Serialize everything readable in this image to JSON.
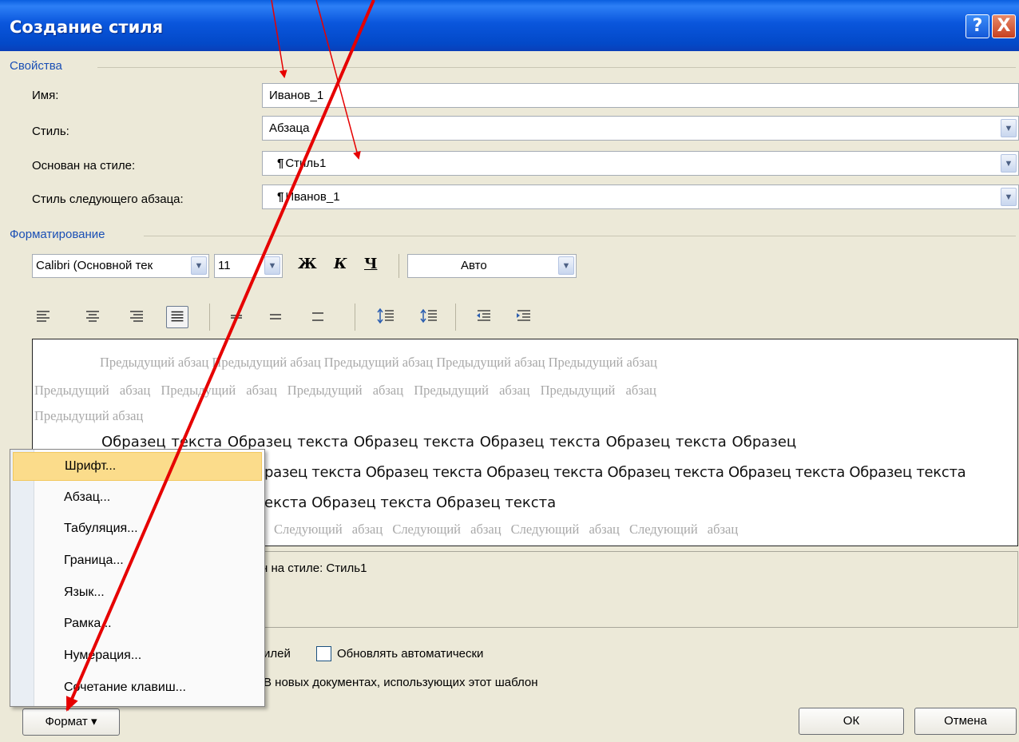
{
  "window": {
    "title": "Создание стиля",
    "help": "?",
    "close": "X"
  },
  "properties": {
    "section": "Свойства",
    "name_label": "Имя:",
    "name_value": "Иванов_1",
    "style_label": "Стиль:",
    "style_value": "Абзаца",
    "based_label": "Основан на стиле:",
    "based_value": "Стиль1",
    "next_label": "Стиль следующего абзаца:",
    "next_value": "Иванов_1"
  },
  "formatting": {
    "section": "Форматирование",
    "font": "Calibri (Основной тек",
    "size": "11",
    "bold": "Ж",
    "italic": "К",
    "underline": "Ч",
    "color": "Авто"
  },
  "preview": {
    "prev_lines": [
      "Предыдущий абзац Предыдущий абзац Предыдущий абзац Предыдущий абзац Предыдущий абзац",
      "Предыдущий абзац Предыдущий абзац Предыдущий абзац Предыдущий абзац Предыдущий абзац",
      "Предыдущий абзац"
    ],
    "sample_lines": [
      "Образец текста Образец текста Образец текста Образец текста Образец текста Образец",
      "разец текста Образец текста Образец текста Образец текста Образец текста Образец текста",
      "екста Образец текста Образец текста"
    ],
    "next_line": "Следующий абзац Следующий абзац Следующий абзац Следующий абзац"
  },
  "description": "н на стиле: Стиль1",
  "options": {
    "add_to_list": "илей",
    "auto_update": "Обновлять автоматически",
    "new_docs": "В новых документах, использующих этот шаблон"
  },
  "menu": {
    "items": [
      "Шрифт...",
      "Абзац...",
      "Табуляция...",
      "Граница...",
      "Язык...",
      "Рамка...",
      "Нумерация...",
      "Сочетание клавиш..."
    ]
  },
  "buttons": {
    "format": "Формат ▾",
    "ok": "ОК",
    "cancel": "Отмена"
  },
  "colors": {
    "title_bar": "#0a56dc",
    "section_label": "#1a4fb5",
    "menu_hover": "#fbdc8b",
    "annotation_arrow": "#e60000"
  }
}
